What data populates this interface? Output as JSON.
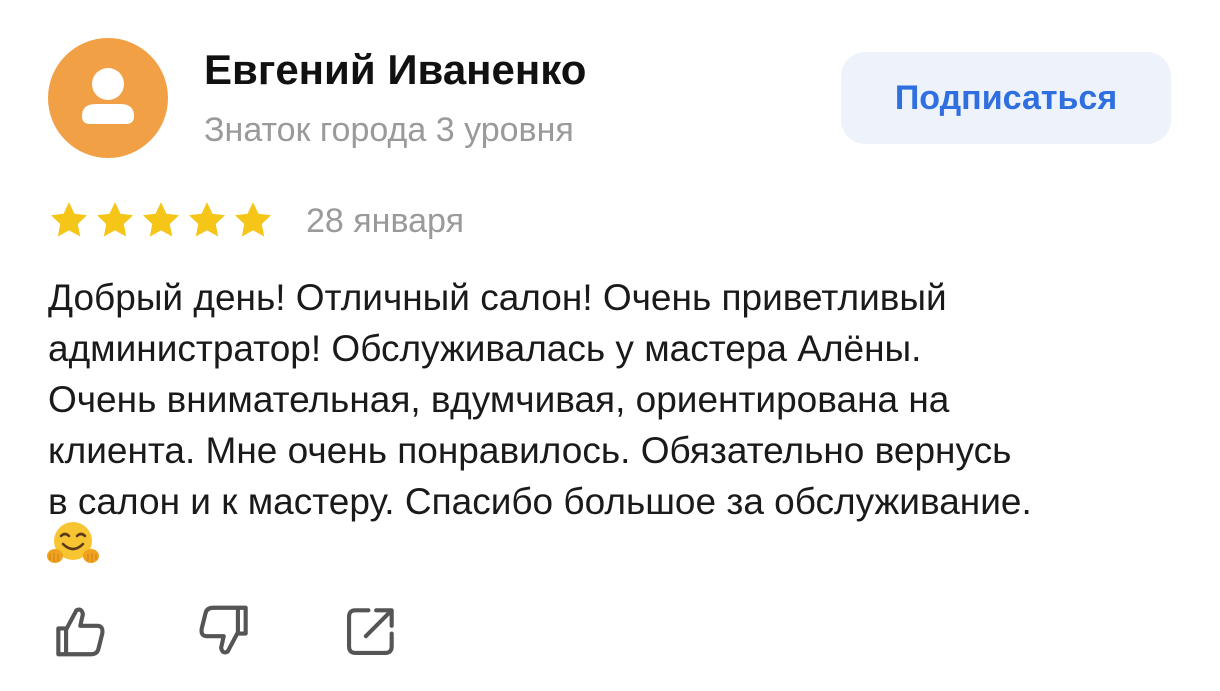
{
  "author": {
    "name": "Евгений Иваненко",
    "level": "Знаток города 3 уровня",
    "avatar_icon": "user-silhouette-icon",
    "avatar_color": "#f2a045"
  },
  "subscribe_button": {
    "label": "Подписаться",
    "color": "#2f6fe0",
    "background": "#eef3fb"
  },
  "review": {
    "rating": 5,
    "rating_max": 5,
    "star_color": "#f5c518",
    "date": "28 января",
    "text_lines": [
      "Добрый день! Отличный салон! Очень приветливый",
      "администратор! Обслуживалась  у мастера Алёны.",
      "Очень внимательная, вдумчивая, ориентирована на",
      "клиента. Мне очень понравилось. Обязательно вернусь",
      "в салон и к мастеру. Спасибо большое за обслуживание."
    ],
    "emoji_icon": "hugging-face-emoji"
  },
  "actions": [
    {
      "icon": "thumbs-up-icon"
    },
    {
      "icon": "thumbs-down-icon"
    },
    {
      "icon": "share-icon"
    }
  ]
}
